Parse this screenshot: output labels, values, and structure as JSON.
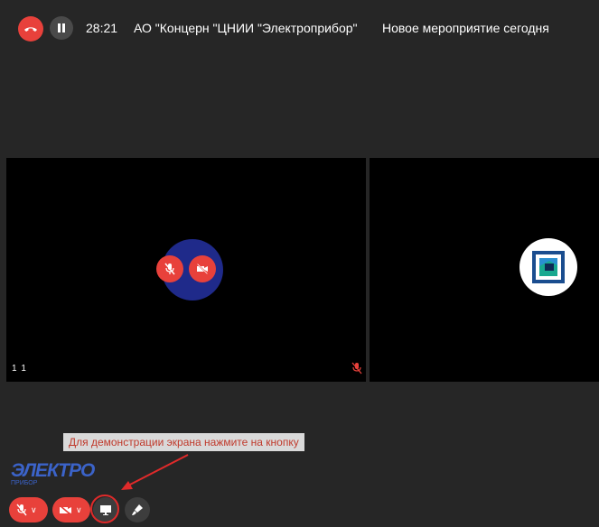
{
  "header": {
    "timer": "28:21",
    "organization": "АО \"Концерн \"ЦНИИ \"Электроприбор\"",
    "event_title": "Новое мероприятие сегодня"
  },
  "participants": [
    {
      "name": "1 1",
      "mic": "muted",
      "camera": "off"
    },
    {
      "name": "",
      "avatar": "organization-logo"
    }
  ],
  "hint": {
    "text": "Для демонстрации экрана нажмите на кнопку"
  },
  "brand": {
    "line1": "ЭЛЕКТРО",
    "line2": "ПРИБОР"
  },
  "colors": {
    "accent_red": "#e8413b",
    "background": "#262626",
    "tile": "#000000",
    "avatar_blue": "#1f2a8a",
    "brand_blue": "#3b63c9"
  },
  "icons": {
    "hangup": "phone-hangup-icon",
    "pause": "pause-icon",
    "mic_muted": "mic-off-icon",
    "camera_off": "camera-off-icon",
    "share_screen": "screen-share-icon",
    "brush": "brush-icon"
  }
}
